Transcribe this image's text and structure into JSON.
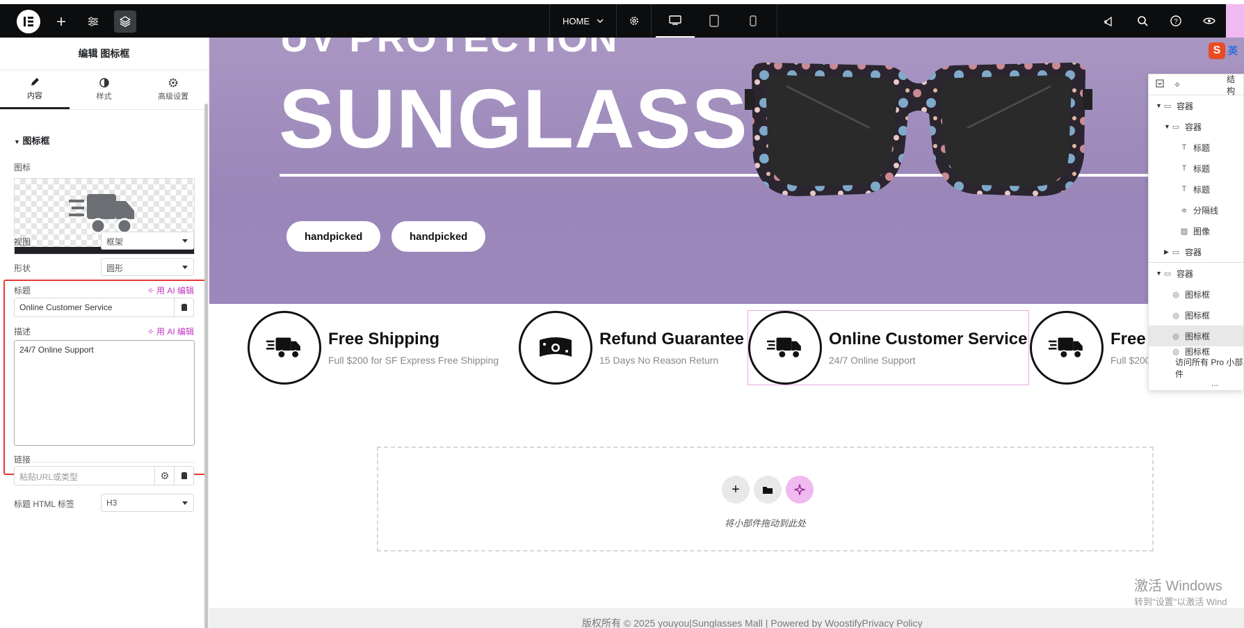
{
  "topbar": {
    "page_name": "HOME",
    "icons": [
      "elementor-logo-icon",
      "add-icon",
      "sliders-icon",
      "layers-icon",
      "settings-icon",
      "desktop-icon",
      "tablet-icon",
      "mobile-icon",
      "notifications-icon",
      "search-icon",
      "help-icon",
      "preview-eye-icon"
    ]
  },
  "panel": {
    "title": "编辑 图标框",
    "tabs": [
      {
        "label": "内容",
        "icon": "pencil-icon"
      },
      {
        "label": "样式",
        "icon": "half-circle-icon"
      },
      {
        "label": "高级设置",
        "icon": "gear-icon"
      }
    ],
    "section": "图标框",
    "icon_label": "图标",
    "view_label": "视图",
    "view_value": "框架",
    "shape_label": "形状",
    "shape_value": "圆形",
    "title_label": "标题",
    "ai_edit": "用 AI 编辑",
    "title_value": "Online Customer Service",
    "desc_label": "描述",
    "desc_value": "24/7 Online Support",
    "link_label": "链接",
    "link_placeholder": "粘贴URL或类型",
    "html_tag_label": "标题 HTML 标签",
    "html_tag_value": "H3"
  },
  "hero": {
    "top_text": "UV PROTECTION",
    "title": "SUNGLASSES",
    "pills": [
      "handpicked",
      "handpicked"
    ]
  },
  "features": [
    {
      "title": "Free Shipping",
      "desc": "Full $200 for SF Express Free Shipping",
      "icon": "truck-icon"
    },
    {
      "title": "Refund Guarantee",
      "desc": "15 Days No Reason Return",
      "icon": "money-bill-icon"
    },
    {
      "title": "Online Customer Service",
      "desc": "24/7 Online Support",
      "icon": "truck-icon"
    },
    {
      "title": "Free",
      "desc": "Full $200",
      "icon": "truck-icon"
    }
  ],
  "dropzone": {
    "text": "将小部件拖动到此处"
  },
  "footer": {
    "text": "版权所有 © 2025 youyou|Sunglasses Mall | Powered by WoostifyPrivacy Policy"
  },
  "watermark": {
    "line1": "激活 Windows",
    "line2": "转到\"设置\"以激活 Wind"
  },
  "navigator": {
    "header": "结构",
    "items": [
      {
        "label": "容器",
        "depth": 0,
        "arrow": "down"
      },
      {
        "label": "容器",
        "depth": 1,
        "arrow": "down"
      },
      {
        "label": "标题",
        "depth": 2,
        "arrow": ""
      },
      {
        "label": "标题",
        "depth": 2,
        "arrow": ""
      },
      {
        "label": "标题",
        "depth": 2,
        "arrow": ""
      },
      {
        "label": "分隔线",
        "depth": 2,
        "arrow": ""
      },
      {
        "label": "图像",
        "depth": 2,
        "arrow": ""
      },
      {
        "label": "容器",
        "depth": 1,
        "arrow": "right"
      },
      {
        "label": "容器",
        "depth": 0,
        "arrow": "down"
      },
      {
        "label": "图标框",
        "depth": 1,
        "arrow": ""
      },
      {
        "label": "图标框",
        "depth": 1,
        "arrow": ""
      },
      {
        "label": "图标框",
        "depth": 1,
        "arrow": ""
      },
      {
        "label": "图标框",
        "depth": 1,
        "arrow": ""
      }
    ],
    "pro_text": "访问所有 Pro 小部件",
    "more": "..."
  },
  "ime": {
    "label": "英"
  },
  "colors": {
    "topbar": "#0c0d0e",
    "accent": "#c036c0",
    "highlight": "#e53935",
    "hero": "#a996c2"
  }
}
